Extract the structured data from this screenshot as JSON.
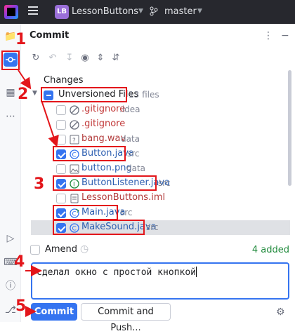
{
  "titlebar": {
    "project_badge": "LB",
    "project_name": "LessonButtons",
    "branch": "master"
  },
  "panel": {
    "title": "Commit",
    "changes_label": "Changes",
    "group": {
      "label": "Unversioned Files",
      "count": "13 files"
    },
    "files": [
      {
        "name": ".gitignore",
        "dir": ".idea",
        "icon": "ignored-icon",
        "checked": false
      },
      {
        "name": ".gitignore",
        "dir": "",
        "icon": "ignored-icon",
        "checked": false
      },
      {
        "name": "bang.wav",
        "dir": "data",
        "icon": "unknown-file-icon",
        "checked": false
      },
      {
        "name": "Button.java",
        "dir": "src",
        "icon": "class-icon",
        "checked": true
      },
      {
        "name": "button.png",
        "dir": "data",
        "icon": "image-icon",
        "checked": false
      },
      {
        "name": "ButtonListener.java",
        "dir": "src",
        "icon": "interface-icon",
        "checked": true
      },
      {
        "name": "LessonButtons.iml",
        "dir": "",
        "icon": "module-icon",
        "checked": false
      },
      {
        "name": "Main.java",
        "dir": "src",
        "icon": "main-class-icon",
        "checked": true
      },
      {
        "name": "MakeSound.java",
        "dir": "src",
        "icon": "class-icon",
        "checked": true
      }
    ],
    "amend_label": "Amend",
    "added_label": "4 added",
    "message": "сделал окно с простой кнопкой",
    "commit_label": "Commit",
    "commit_push_label": "Commit and Push..."
  },
  "annotations": [
    "1",
    "2",
    "3",
    "4",
    "5"
  ],
  "colors": {
    "accent": "#3574f0",
    "annotation": "#e3161b",
    "added": "#208a3c"
  }
}
